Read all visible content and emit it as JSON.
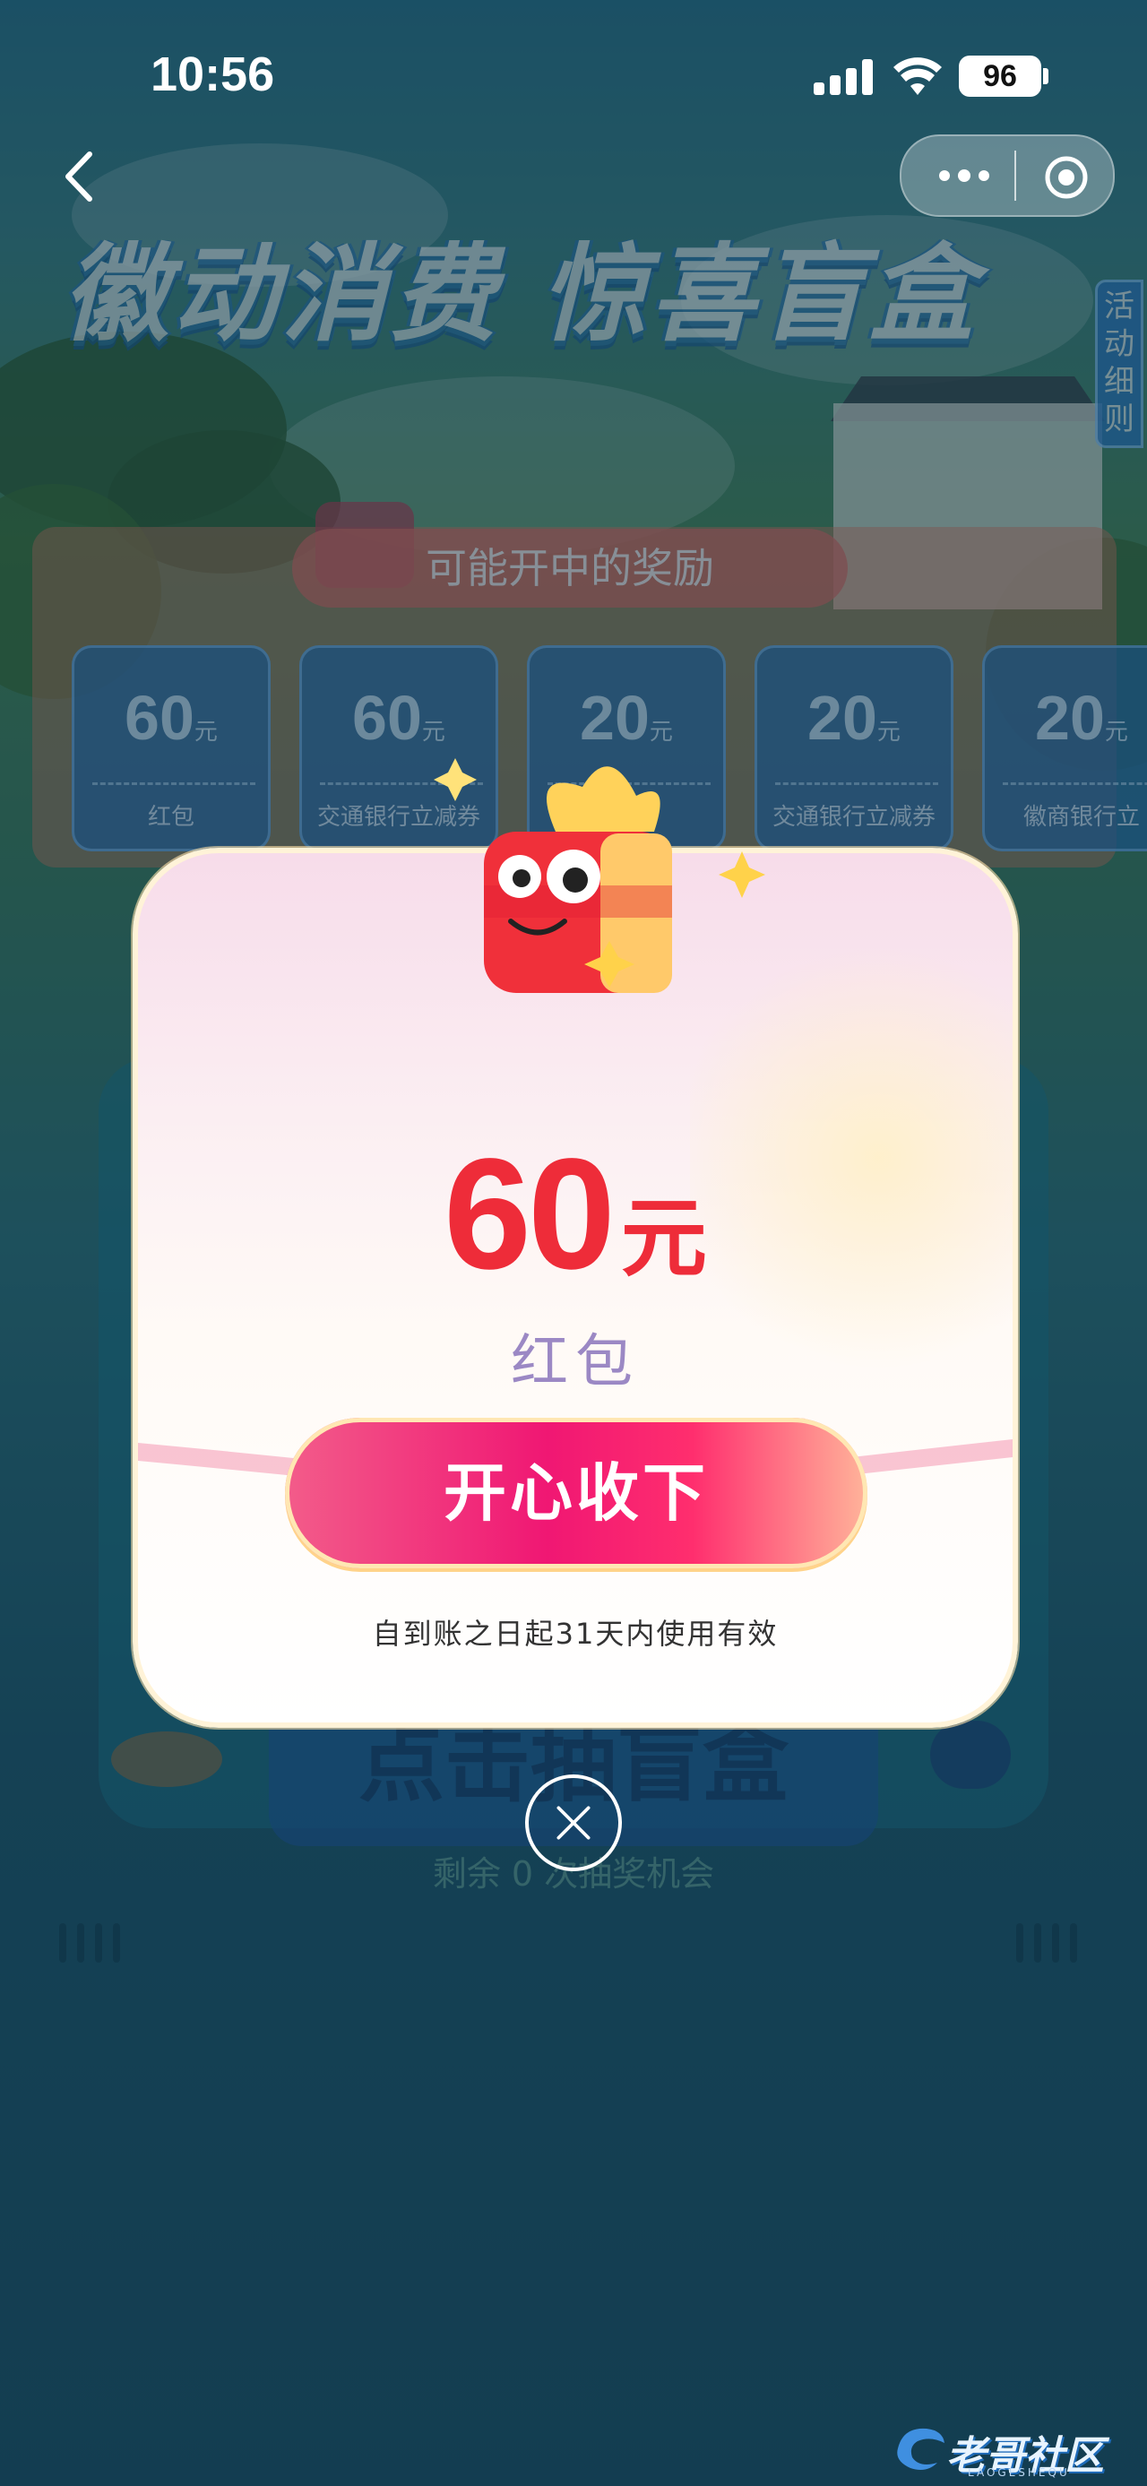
{
  "status_bar": {
    "time": "10:56",
    "battery": "96"
  },
  "banner": {
    "headline": "徽动消费 惊喜盲盒",
    "rules_tab": "活动细则"
  },
  "prizes": {
    "title": "可能开中的奖励",
    "unit": "元",
    "items": [
      {
        "amount": "60",
        "label": "红包"
      },
      {
        "amount": "60",
        "label": "交通银行立减券"
      },
      {
        "amount": "20",
        "label": ""
      },
      {
        "amount": "20",
        "label": "交通银行立减券"
      },
      {
        "amount": "20",
        "label": "徽商银行立"
      }
    ]
  },
  "machine": {
    "button_text": "点击抽盲盒",
    "remaining": "剩余 0 次抽奖机会"
  },
  "modal": {
    "amount": "60",
    "unit": "元",
    "prize_type": "红包",
    "accept_button": "开心收下",
    "validity": "自到账之日起31天内使用有效"
  },
  "watermark": {
    "text": "老哥社区",
    "sub": "LAOGESHEQU"
  },
  "colors": {
    "accent": "#ee2c39",
    "button_pink": "#f01773",
    "prize_type": "#9b88c4"
  }
}
